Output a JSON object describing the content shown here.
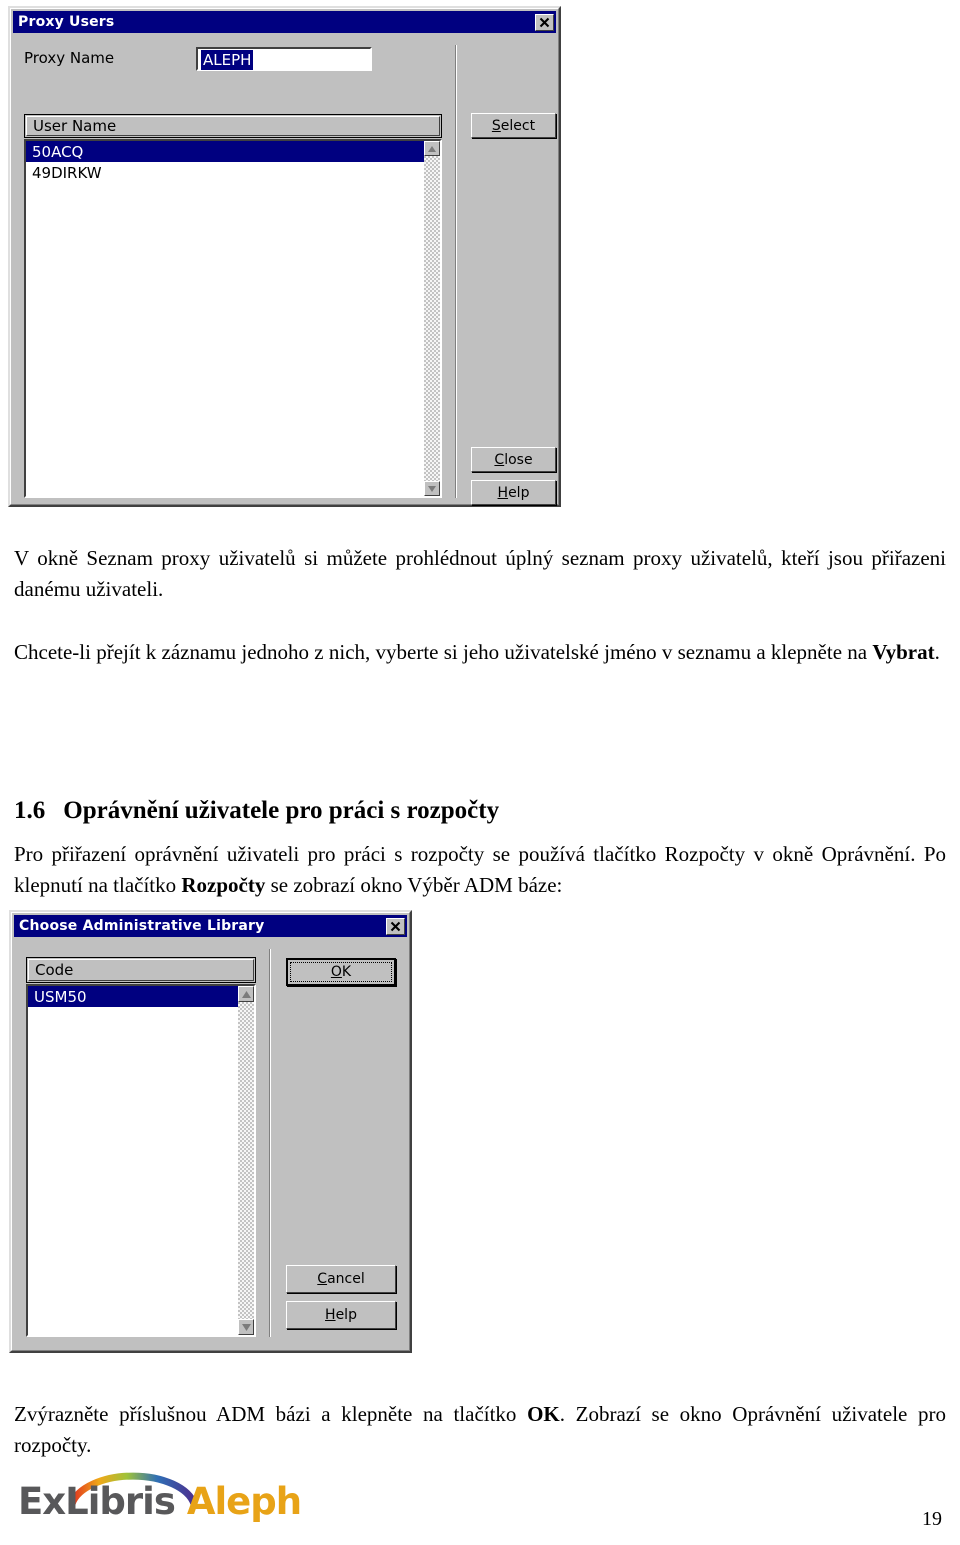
{
  "page": {
    "number": "19"
  },
  "dialog_proxy_users": {
    "title": "Proxy Users",
    "close_icon": "close-icon",
    "proxy_name_label": "Proxy Name",
    "proxy_name_value": "ALEPH",
    "list_header": "User Name",
    "list_items": [
      {
        "label": "50ACQ",
        "selected": true
      },
      {
        "label": "49DIRKW",
        "selected": false
      }
    ],
    "buttons": {
      "select": "Select",
      "select_accesskey": "S",
      "close": "Close",
      "close_accesskey": "C",
      "help": "Help",
      "help_accesskey": "H"
    },
    "scroll_up_icon": "scroll-up-arrow-icon",
    "scroll_down_icon": "scroll-down-arrow-icon"
  },
  "body_text": {
    "paragraph_1": "V okně Seznam proxy uživatelů si můžete prohlédnout úplný seznam proxy uživatelů, kteří jsou přiřazeni danému uživateli.",
    "paragraph_2_before": "Chcete-li přejít k záznamu jednoho z nich, vyberte si jeho uživatelské jméno v seznamu a klepněte na ",
    "paragraph_2_bold": "Vybrat",
    "paragraph_2_after": ".",
    "heading_number": "1.6",
    "heading_title": "Oprávnění uživatele pro práci s rozpočty",
    "paragraph_3_before": "Pro přiřazení oprávnění uživateli pro práci s rozpočty se používá tlačítko Rozpočty v okně Oprávnění. Po klepnutí na tlačítko ",
    "paragraph_3_bold": "Rozpočty",
    "paragraph_3_after": " se zobrazí okno Výběr ADM báze:",
    "paragraph_4_before": "Zvýrazněte příslušnou ADM bázi a klepněte na tlačítko ",
    "paragraph_4_bold": "OK",
    "paragraph_4_after": ". Zobrazí se okno Oprávnění uživatele pro rozpočty."
  },
  "dialog_choose_admin_library": {
    "title": "Choose Administrative Library",
    "close_icon": "close-icon",
    "list_header": "Code",
    "list_items": [
      {
        "label": "USM50",
        "selected": true
      }
    ],
    "buttons": {
      "ok": "OK",
      "ok_accesskey": "O",
      "cancel": "Cancel",
      "cancel_accesskey": "C",
      "help": "Help",
      "help_accesskey": "H"
    },
    "scroll_up_icon": "scroll-up-arrow-icon",
    "scroll_down_icon": "scroll-down-arrow-icon"
  },
  "footer_logo": {
    "brand": "ExLibris",
    "product": "Aleph",
    "arc_colors": [
      "#e03020",
      "#f0a818",
      "#7fb52e",
      "#2f6fb5",
      "#4b2f8f"
    ]
  },
  "colors": {
    "titlebar": "#000080",
    "dialog_face": "#c0c0c0",
    "selection": "#000080",
    "logo_gray": "#58585a",
    "logo_orange": "#e8a317"
  }
}
